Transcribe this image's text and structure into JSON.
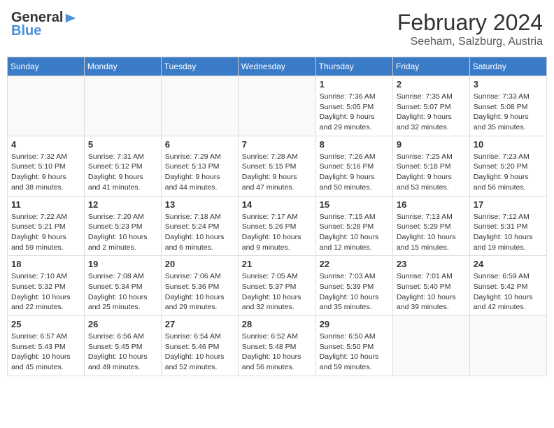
{
  "header": {
    "logo_general": "General",
    "logo_blue": "Blue",
    "month_year": "February 2024",
    "location": "Seeham, Salzburg, Austria"
  },
  "weekdays": [
    "Sunday",
    "Monday",
    "Tuesday",
    "Wednesday",
    "Thursday",
    "Friday",
    "Saturday"
  ],
  "weeks": [
    [
      {
        "day": "",
        "info": ""
      },
      {
        "day": "",
        "info": ""
      },
      {
        "day": "",
        "info": ""
      },
      {
        "day": "",
        "info": ""
      },
      {
        "day": "1",
        "info": "Sunrise: 7:36 AM\nSunset: 5:05 PM\nDaylight: 9 hours\nand 29 minutes."
      },
      {
        "day": "2",
        "info": "Sunrise: 7:35 AM\nSunset: 5:07 PM\nDaylight: 9 hours\nand 32 minutes."
      },
      {
        "day": "3",
        "info": "Sunrise: 7:33 AM\nSunset: 5:08 PM\nDaylight: 9 hours\nand 35 minutes."
      }
    ],
    [
      {
        "day": "4",
        "info": "Sunrise: 7:32 AM\nSunset: 5:10 PM\nDaylight: 9 hours\nand 38 minutes."
      },
      {
        "day": "5",
        "info": "Sunrise: 7:31 AM\nSunset: 5:12 PM\nDaylight: 9 hours\nand 41 minutes."
      },
      {
        "day": "6",
        "info": "Sunrise: 7:29 AM\nSunset: 5:13 PM\nDaylight: 9 hours\nand 44 minutes."
      },
      {
        "day": "7",
        "info": "Sunrise: 7:28 AM\nSunset: 5:15 PM\nDaylight: 9 hours\nand 47 minutes."
      },
      {
        "day": "8",
        "info": "Sunrise: 7:26 AM\nSunset: 5:16 PM\nDaylight: 9 hours\nand 50 minutes."
      },
      {
        "day": "9",
        "info": "Sunrise: 7:25 AM\nSunset: 5:18 PM\nDaylight: 9 hours\nand 53 minutes."
      },
      {
        "day": "10",
        "info": "Sunrise: 7:23 AM\nSunset: 5:20 PM\nDaylight: 9 hours\nand 56 minutes."
      }
    ],
    [
      {
        "day": "11",
        "info": "Sunrise: 7:22 AM\nSunset: 5:21 PM\nDaylight: 9 hours\nand 59 minutes."
      },
      {
        "day": "12",
        "info": "Sunrise: 7:20 AM\nSunset: 5:23 PM\nDaylight: 10 hours\nand 2 minutes."
      },
      {
        "day": "13",
        "info": "Sunrise: 7:18 AM\nSunset: 5:24 PM\nDaylight: 10 hours\nand 6 minutes."
      },
      {
        "day": "14",
        "info": "Sunrise: 7:17 AM\nSunset: 5:26 PM\nDaylight: 10 hours\nand 9 minutes."
      },
      {
        "day": "15",
        "info": "Sunrise: 7:15 AM\nSunset: 5:28 PM\nDaylight: 10 hours\nand 12 minutes."
      },
      {
        "day": "16",
        "info": "Sunrise: 7:13 AM\nSunset: 5:29 PM\nDaylight: 10 hours\nand 15 minutes."
      },
      {
        "day": "17",
        "info": "Sunrise: 7:12 AM\nSunset: 5:31 PM\nDaylight: 10 hours\nand 19 minutes."
      }
    ],
    [
      {
        "day": "18",
        "info": "Sunrise: 7:10 AM\nSunset: 5:32 PM\nDaylight: 10 hours\nand 22 minutes."
      },
      {
        "day": "19",
        "info": "Sunrise: 7:08 AM\nSunset: 5:34 PM\nDaylight: 10 hours\nand 25 minutes."
      },
      {
        "day": "20",
        "info": "Sunrise: 7:06 AM\nSunset: 5:36 PM\nDaylight: 10 hours\nand 29 minutes."
      },
      {
        "day": "21",
        "info": "Sunrise: 7:05 AM\nSunset: 5:37 PM\nDaylight: 10 hours\nand 32 minutes."
      },
      {
        "day": "22",
        "info": "Sunrise: 7:03 AM\nSunset: 5:39 PM\nDaylight: 10 hours\nand 35 minutes."
      },
      {
        "day": "23",
        "info": "Sunrise: 7:01 AM\nSunset: 5:40 PM\nDaylight: 10 hours\nand 39 minutes."
      },
      {
        "day": "24",
        "info": "Sunrise: 6:59 AM\nSunset: 5:42 PM\nDaylight: 10 hours\nand 42 minutes."
      }
    ],
    [
      {
        "day": "25",
        "info": "Sunrise: 6:57 AM\nSunset: 5:43 PM\nDaylight: 10 hours\nand 45 minutes."
      },
      {
        "day": "26",
        "info": "Sunrise: 6:56 AM\nSunset: 5:45 PM\nDaylight: 10 hours\nand 49 minutes."
      },
      {
        "day": "27",
        "info": "Sunrise: 6:54 AM\nSunset: 5:46 PM\nDaylight: 10 hours\nand 52 minutes."
      },
      {
        "day": "28",
        "info": "Sunrise: 6:52 AM\nSunset: 5:48 PM\nDaylight: 10 hours\nand 56 minutes."
      },
      {
        "day": "29",
        "info": "Sunrise: 6:50 AM\nSunset: 5:50 PM\nDaylight: 10 hours\nand 59 minutes."
      },
      {
        "day": "",
        "info": ""
      },
      {
        "day": "",
        "info": ""
      }
    ]
  ]
}
